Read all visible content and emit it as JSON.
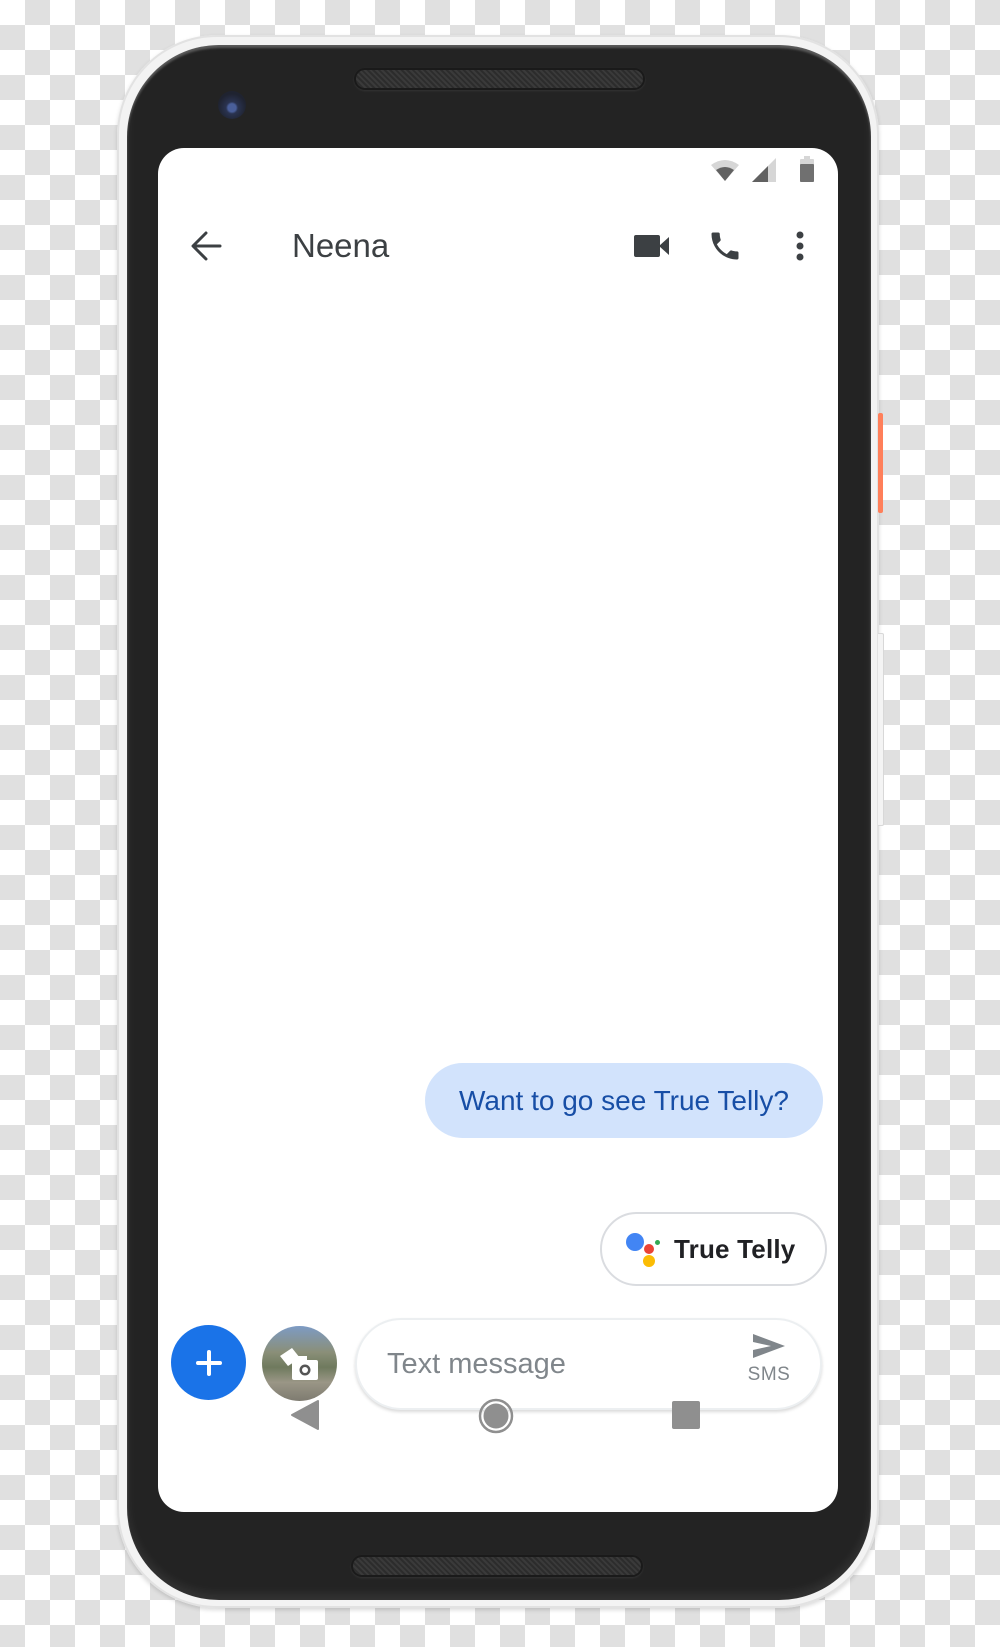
{
  "device": {
    "accent_color": "#ff7f5a"
  },
  "status_bar": {
    "icons": [
      "wifi-icon",
      "cell-signal-icon",
      "battery-icon"
    ]
  },
  "app_bar": {
    "back_icon": "arrow-back-icon",
    "title": "Neena",
    "actions": [
      {
        "name": "video-call",
        "icon": "videocam-icon"
      },
      {
        "name": "voice-call",
        "icon": "phone-icon"
      },
      {
        "name": "more-options",
        "icon": "more-vert-icon"
      }
    ]
  },
  "conversation": {
    "messages": [
      {
        "direction": "outgoing",
        "text": "Want to go see True Telly?",
        "bubble_color": "#d2e3fc",
        "text_color": "#174ea6"
      }
    ]
  },
  "suggestion_chip": {
    "icon": "google-assistant-icon",
    "label": "True Telly",
    "assistant_colors": [
      "#4285f4",
      "#ea4335",
      "#fbbc04",
      "#34a853"
    ]
  },
  "compose": {
    "add_button_icon": "plus-icon",
    "add_button_color": "#1a73e8",
    "gallery_button_icon": "camera-gallery-icon",
    "input_value": "",
    "input_placeholder": "Text message",
    "send_icon": "send-icon",
    "send_mode_label": "SMS"
  },
  "nav_bar": {
    "items": [
      {
        "name": "back",
        "icon": "nav-back-icon"
      },
      {
        "name": "home",
        "icon": "nav-home-icon"
      },
      {
        "name": "recents",
        "icon": "nav-recents-icon"
      }
    ]
  }
}
